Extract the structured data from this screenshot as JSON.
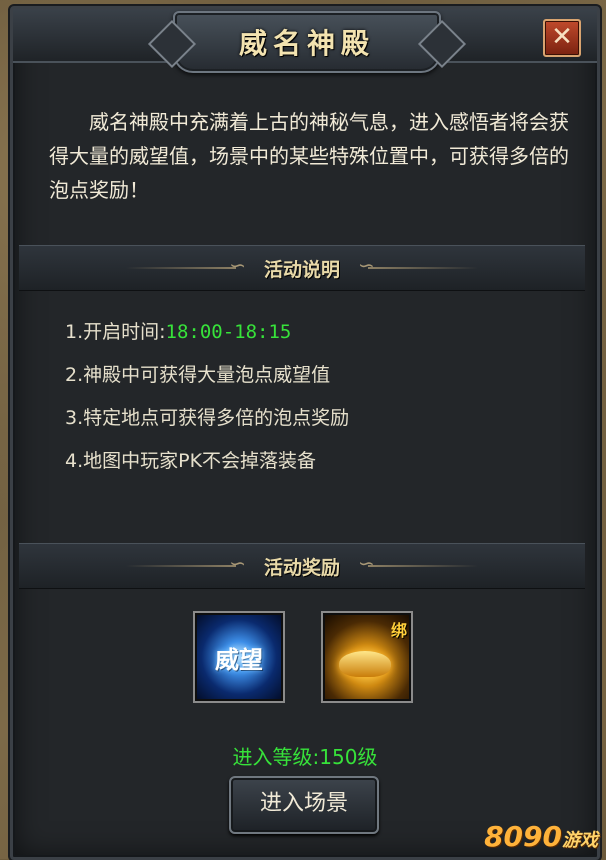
{
  "window": {
    "title": "威名神殿",
    "close_label": "✕"
  },
  "intro": {
    "text": "威名神殿中充满着上古的神秘气息，进入感悟者将会获得大量的威望值，场景中的某些特殊位置中，可获得多倍的泡点奖励！"
  },
  "activity_section": {
    "heading": "活动说明",
    "rules": [
      {
        "prefix": "1.开启时间:",
        "highlight": "18:00-18:15"
      },
      {
        "prefix": "2.神殿中可获得大量泡点威望值",
        "highlight": ""
      },
      {
        "prefix": "3.特定地点可获得多倍的泡点奖励",
        "highlight": ""
      },
      {
        "prefix": "4.地图中玩家PK不会掉落装备",
        "highlight": ""
      }
    ]
  },
  "reward_section": {
    "heading": "活动奖励",
    "items": [
      {
        "label": "威望",
        "icon": "prestige-icon"
      },
      {
        "badge": "绑",
        "icon": "gold-ingot-icon"
      }
    ]
  },
  "footer": {
    "level_requirement": "进入等级:150级",
    "enter_button": "进入场景"
  },
  "watermark": {
    "brand": "8090",
    "suffix": "游戏"
  },
  "colors": {
    "highlight_green": "#37e23a",
    "title_gold": "#f3e3b0",
    "close_red": "#c04a2c"
  }
}
